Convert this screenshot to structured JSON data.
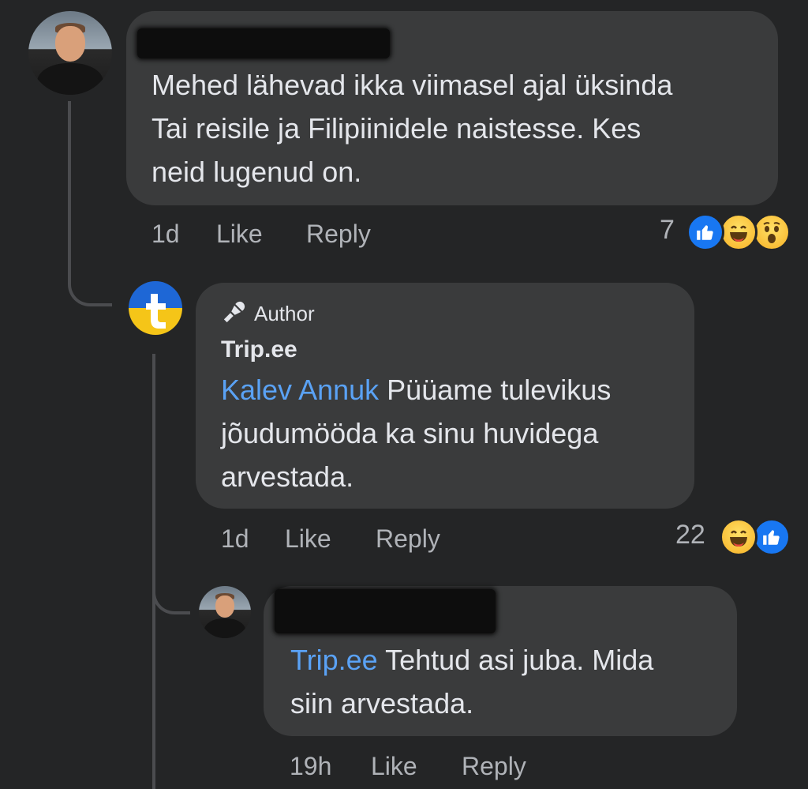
{
  "comments": [
    {
      "text": "Mehed lähevad ikka viimasel ajal üksinda Tai reisile ja Filipiinidele naistesse. Kes neid lugenud on.",
      "lines": [
        "Mehed lähevad ikka viimasel ajal üksinda",
        "Tai reisile ja Filipiinidele naistesse. Kes",
        "neid lugenud on."
      ],
      "time": "1d",
      "like_label": "Like",
      "reply_label": "Reply",
      "reaction_count": "7",
      "reactions": [
        "like-icon",
        "haha-icon",
        "wow-icon"
      ]
    },
    {
      "badge": "Author",
      "author": "Trip.ee",
      "mention": "Kalev Annuk",
      "lines": [
        "Püüame tulevikus",
        "jõudumööda ka sinu huvidega",
        "arvestada."
      ],
      "time": "1d",
      "like_label": "Like",
      "reply_label": "Reply",
      "reaction_count": "22",
      "reactions": [
        "haha-icon",
        "like-icon"
      ]
    },
    {
      "mention": "Trip.ee",
      "lines": [
        "Tehtud asi juba. Mida",
        "siin arvestada."
      ],
      "time": "19h",
      "like_label": "Like",
      "reply_label": "Reply"
    }
  ],
  "colors": {
    "background": "#242526",
    "bubble": "#3a3b3c",
    "mention": "#5aa2f5",
    "like_blue": "#1877f2"
  }
}
